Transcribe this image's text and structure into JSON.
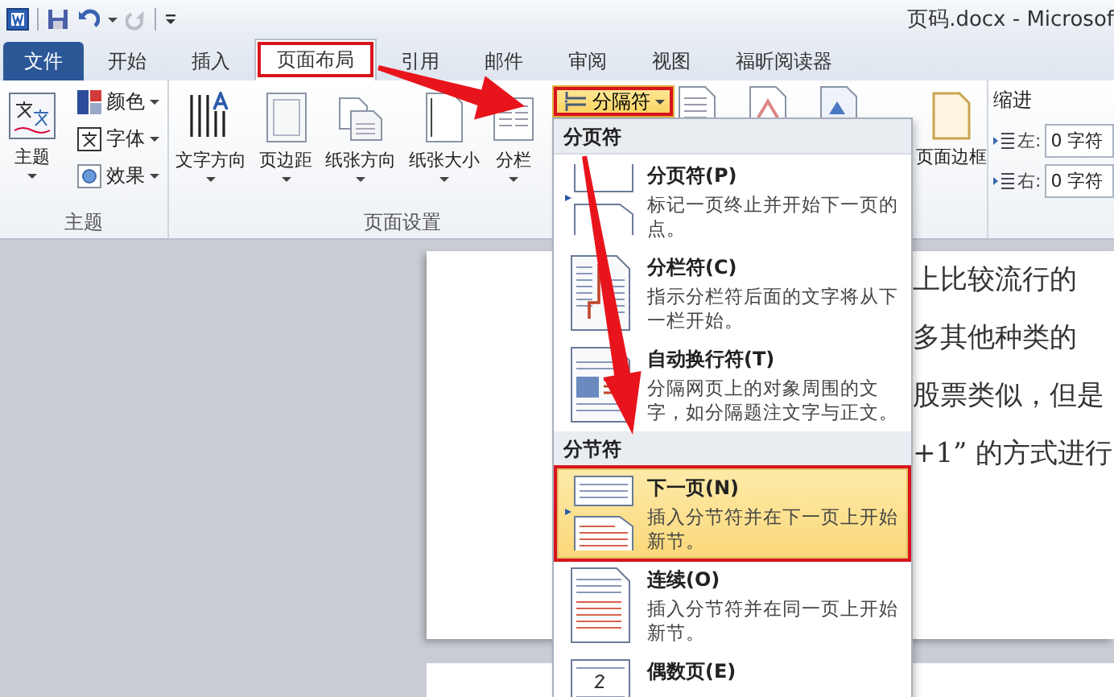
{
  "title_bar": {
    "title": "页码.docx - Microsof"
  },
  "tabs": [
    {
      "label": "文件",
      "kind": "file",
      "selected": false,
      "annotated": false
    },
    {
      "label": "开始",
      "kind": "tab",
      "selected": false,
      "annotated": false
    },
    {
      "label": "插入",
      "kind": "tab",
      "selected": false,
      "annotated": false
    },
    {
      "label": "页面布局",
      "kind": "tab",
      "selected": true,
      "annotated": true
    },
    {
      "label": "引用",
      "kind": "tab",
      "selected": false,
      "annotated": false
    },
    {
      "label": "邮件",
      "kind": "tab",
      "selected": false,
      "annotated": false
    },
    {
      "label": "审阅",
      "kind": "tab",
      "selected": false,
      "annotated": false
    },
    {
      "label": "视图",
      "kind": "tab",
      "selected": false,
      "annotated": false
    },
    {
      "label": "福昕阅读器",
      "kind": "tab",
      "selected": false,
      "annotated": false
    }
  ],
  "ribbon": {
    "theme_group": {
      "label": "主题",
      "big_button": {
        "label": "主题",
        "dropdown": true
      },
      "small_buttons": [
        {
          "label": "颜色",
          "kind": "colors",
          "dropdown": true
        },
        {
          "label": "字体",
          "kind": "fonts",
          "dropdown": true
        },
        {
          "label": "效果",
          "kind": "effects",
          "dropdown": true
        }
      ]
    },
    "page_setup_group": {
      "label": "页面设置",
      "big_buttons": [
        {
          "label": "文字方向",
          "kind": "text-direction",
          "dropdown": true
        },
        {
          "label": "页边距",
          "kind": "margins",
          "dropdown": true
        },
        {
          "label": "纸张方向",
          "kind": "orientation",
          "dropdown": true
        },
        {
          "label": "纸张大小",
          "kind": "size",
          "dropdown": true
        },
        {
          "label": "分栏",
          "kind": "columns",
          "dropdown": true
        }
      ],
      "breaks_button": {
        "label": "分隔符",
        "dropdown": true,
        "selected": true,
        "annotated": true
      }
    },
    "page_border": {
      "label": "页面边框"
    },
    "indent": {
      "title": "缩进",
      "fields": [
        {
          "label": "左:",
          "value": "0 字符"
        },
        {
          "label": "右:",
          "value": "0 字符"
        }
      ]
    }
  },
  "document": {
    "lines": [
      "上比较流行的",
      "多其他种类的",
      "股票类似，但是",
      "+1” 的方式进行"
    ]
  },
  "breaks_menu": {
    "sections": [
      {
        "title": "分页符",
        "items": [
          {
            "kind": "page",
            "title": "分页符(P)",
            "description": "标记一页终止并开始下一页的点。",
            "selected": false,
            "annotated": false
          },
          {
            "kind": "column",
            "title": "分栏符(C)",
            "description": "指示分栏符后面的文字将从下一栏开始。",
            "selected": false,
            "annotated": false
          },
          {
            "kind": "wrap",
            "title": "自动换行符(T)",
            "description": "分隔网页上的对象周围的文字，如分隔题注文字与正文。",
            "selected": false,
            "annotated": false
          }
        ]
      },
      {
        "title": "分节符",
        "items": [
          {
            "kind": "next",
            "title": "下一页(N)",
            "description": "插入分节符并在下一页上开始新节。",
            "selected": true,
            "annotated": true
          },
          {
            "kind": "continuous",
            "title": "连续(O)",
            "description": "插入分节符并在同一页上开始新节。",
            "selected": false,
            "annotated": false
          },
          {
            "kind": "even",
            "title": "偶数页(E)",
            "selected": false,
            "annotated": false
          }
        ]
      }
    ]
  }
}
